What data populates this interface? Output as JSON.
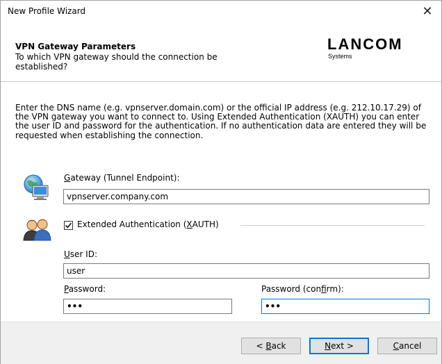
{
  "window": {
    "title": "New Profile Wizard",
    "close_glyph": "✕"
  },
  "header": {
    "title": "VPN Gateway Parameters",
    "subtitle": "To which VPN gateway should the connection be established?",
    "logo_brand": "LANCOM",
    "logo_tag": "Systems"
  },
  "description": "Enter the DNS name (e.g. vpnserver.domain.com) or the official IP address (e.g. 212.10.17.29) of the VPN gateway you want to connect to. Using Extended Authentication (XAUTH) you can enter the user ID and password for the authentication. If no authentication data are entered they will be requested when establishing the connection.",
  "gateway": {
    "label_mnemonic": "G",
    "label_rest": "ateway (Tunnel Endpoint):",
    "value": "vpnserver.company.com"
  },
  "xauth": {
    "checked": true,
    "label_before": "Extended Authentication (",
    "label_mnemonic": "X",
    "label_after": "AUTH)"
  },
  "user_id": {
    "label_mnemonic": "U",
    "label_rest": "ser ID:",
    "value": "user"
  },
  "password": {
    "label_mnemonic": "P",
    "label_rest": "assword:",
    "value": "•••"
  },
  "password_confirm": {
    "label_before": "Password (con",
    "label_mnemonic": "f",
    "label_after": "irm):",
    "value": "•••"
  },
  "buttons": {
    "back": {
      "prefix": "< ",
      "mnemonic": "B",
      "rest": "ack"
    },
    "next": {
      "mnemonic": "N",
      "rest": "ext >"
    },
    "cancel": {
      "mnemonic": "C",
      "rest": "ancel"
    }
  },
  "colors": {
    "accent": "#0078d7",
    "footer_bg": "#f0f0f0",
    "button_bg": "#e1e1e1"
  }
}
